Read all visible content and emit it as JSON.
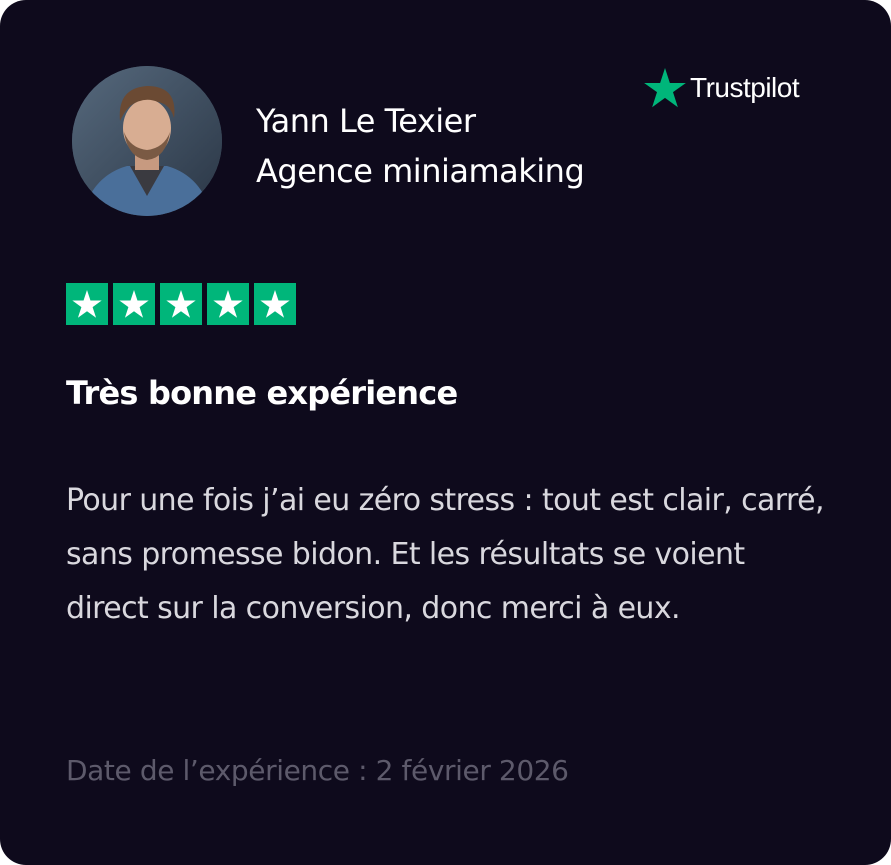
{
  "platform": {
    "name": "Trustpilot",
    "icon": "trustpilot-star-icon",
    "brand_color": "#00b67a"
  },
  "reviewer": {
    "name": "Yann Le Texier",
    "company": "Agence miniamaking"
  },
  "rating": {
    "stars": 5,
    "max": 5
  },
  "review": {
    "title": "Très bonne expérience",
    "body": "Pour une fois j’ai eu zéro stress : tout est clair, carré, sans promesse bidon. Et les résultats se voient direct sur la conversion, donc merci à eux.",
    "date": "Date de l’expérience : 2 février 2026"
  },
  "colors": {
    "card_background": "#0e0a1c",
    "text": "#ffffff",
    "muted_text": "#5d5a6b"
  }
}
